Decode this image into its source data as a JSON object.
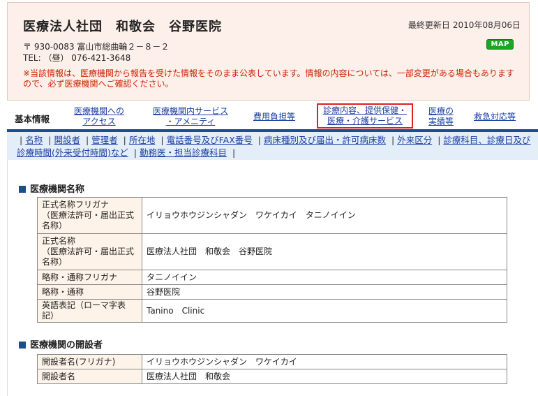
{
  "header": {
    "hospital_name": "医療法人社団　和敬会　谷野医院",
    "updated_label": "最終更新日",
    "updated_date": "2010年08月06日",
    "postal": "〒 930-0083 富山市総曲輪２－８－２",
    "tel": "TEL: （昼） 076-421-3648",
    "map_label": "MAP",
    "notice": "※当該情報は、医療機関から報告を受けた情報をそのまま公表しています。情報の内容については、一部変更がある場合もありますので、必ず医療機関へご確認ください。"
  },
  "nav": {
    "basic": "基本情報",
    "access_1": "医療機関への",
    "access_2": "アクセス",
    "service_1": "医療機関内サービス",
    "service_2": "・アメニティ",
    "cost": "費用負担等",
    "care_1": "診療内容、提供保健・",
    "care_2": "医療・介護サービス",
    "results_1": "医療の",
    "results_2": "実績等",
    "emergency": "救急対応等"
  },
  "sublinks": [
    "名称",
    "開設者",
    "管理者",
    "所在地",
    "電話番号及びFAX番号",
    "病床種別及び届出・許可病床数",
    "外来区分",
    "診療科目、診療日及び診療時間(外来受付時間)など",
    "勤務医・担当診療科目"
  ],
  "section1": {
    "title": "医療機関名称",
    "rows": [
      {
        "k1": "正式名称フリガナ",
        "k2": "（医療法許可・届出正式",
        "k3": "名称）",
        "v": "イリョウホウジンシャダン　ワケイカイ　タニノイイン"
      },
      {
        "k1": "正式名称",
        "k2": "（医療法許可・届出正式",
        "k3": "名称）",
        "v": "医療法人社団　和敬会　谷野医院"
      },
      {
        "k1": "略称・通称フリガナ",
        "v": "タニノイイン"
      },
      {
        "k1": "略称・通称",
        "v": "谷野医院"
      },
      {
        "k1": "英語表記（ローマ字表記）",
        "v": "Tanino　Clinic"
      }
    ]
  },
  "section2": {
    "title": "医療機関の開設者",
    "rows": [
      {
        "k1": "開設者名(フリガナ)",
        "v": "イリョウホウジンシャダン　ワケイカイ"
      },
      {
        "k1": "開設者名",
        "v": "医療法人社団　和敬会"
      }
    ]
  }
}
